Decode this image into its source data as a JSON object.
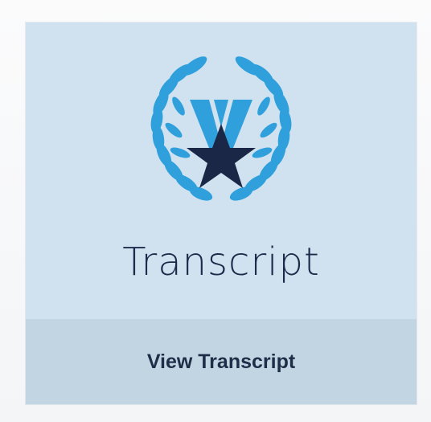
{
  "card": {
    "title": "Transcript",
    "emblem_icon": "laurel-wreath-star-icon",
    "action": {
      "label": "View Transcript"
    }
  },
  "colors": {
    "card_background": "#d0e2ef",
    "footer_background": "#c2d5e2",
    "laurel_blue": "#2fa0dc",
    "star_navy": "#1b2746",
    "title_text": "#1b2b4a"
  }
}
